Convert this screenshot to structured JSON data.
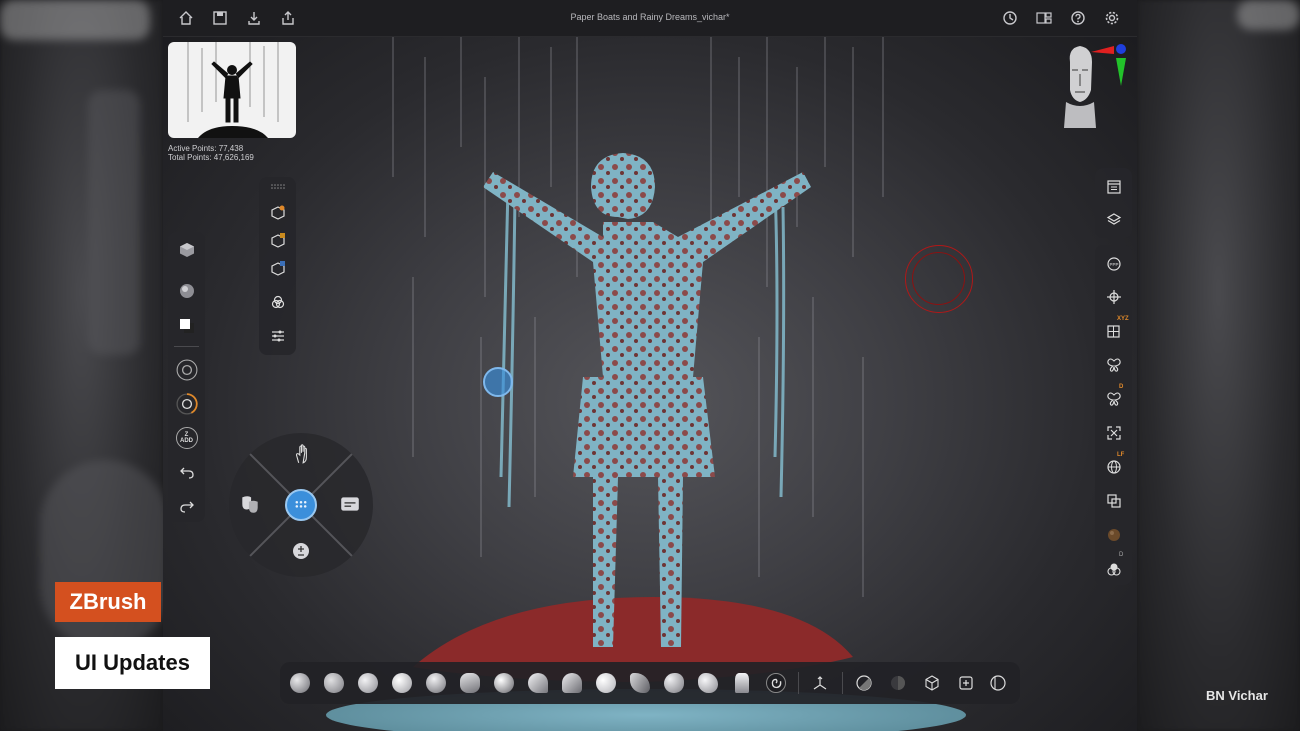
{
  "app": {
    "document_title": "Paper Boats and Rainy Dreams_vichar*"
  },
  "stats": {
    "active_points": "Active Points: 77,438",
    "total_points": "Total Points: 47,626,169"
  },
  "toolbar_left": {
    "add_mode_label_top": "Z",
    "add_mode_label_bottom": "ADD"
  },
  "right_panel": {
    "xyz_badge": "XYZ",
    "d_badge": "D",
    "lf_badge": "LF",
    "d2_badge": "D"
  },
  "overlay": {
    "brand_label": "ZBrush",
    "topic_label": "UI Updates",
    "watermark": "BN Vichar"
  },
  "colors": {
    "accent_blue": "#3b8fdb",
    "accent_orange": "#e0892a",
    "brand_orange": "#d4501f",
    "model_cyan": "#7fb3c4",
    "model_red": "#8b2a2a"
  }
}
